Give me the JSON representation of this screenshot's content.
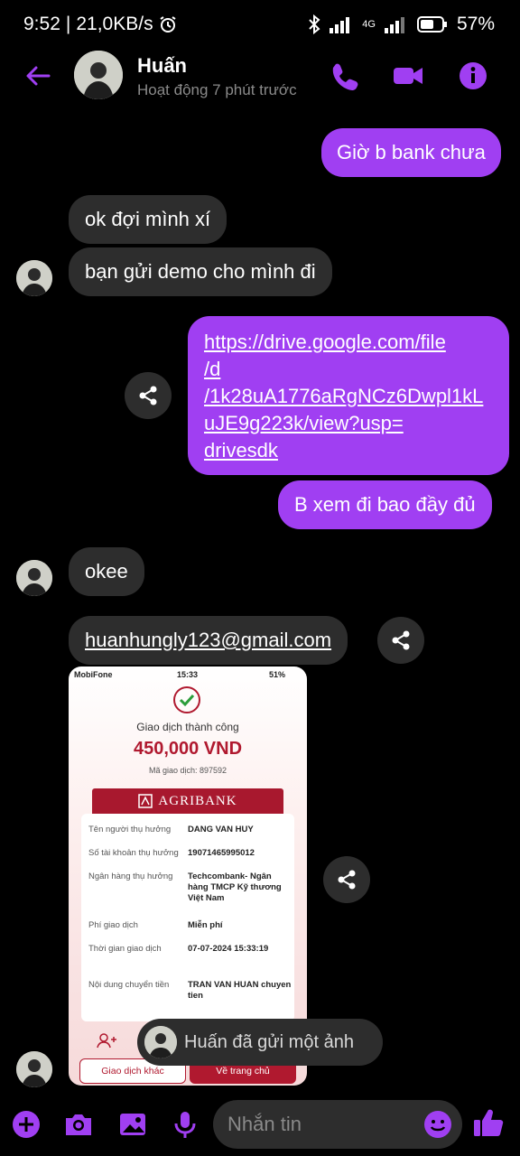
{
  "status_bar": {
    "time": "9:52",
    "speed": "21,0KB/s",
    "network": "4G",
    "battery": "57%"
  },
  "header": {
    "name": "Huấn",
    "subtitle": "Hoạt động 7 phút trước",
    "accent_color": "#a03ff2"
  },
  "messages": [
    {
      "side": "out",
      "text": "Giờ b bank chưa"
    },
    {
      "side": "in",
      "text": "ok đợi mình xí"
    },
    {
      "side": "in",
      "text": "bạn gửi demo cho mình đi"
    },
    {
      "side": "out",
      "link": true,
      "lines": [
        "https://drive.google.com/file",
        "/d",
        "/1k28uA1776aRgNCz6Dwpl1kL",
        "uJE9g223k/view?usp=",
        "drivesdk"
      ]
    },
    {
      "side": "out",
      "text": "B xem đi bao đầy đủ"
    },
    {
      "side": "in",
      "text": "okee"
    },
    {
      "side": "in",
      "link": true,
      "text": "huanhungly123@gmail.com"
    }
  ],
  "receipt": {
    "carrier": "MobiFone",
    "time": "15:33",
    "battery": "51%",
    "title": "Giao dịch thành công",
    "amount": "450,000 VND",
    "code": "Mã giao dịch: 897592",
    "bank": "AGRIBANK",
    "rows": [
      {
        "key": "Tên người thụ hưởng",
        "value": "DANG VAN HUY"
      },
      {
        "key": "Số tài khoản thụ hưởng",
        "value": "19071465995012"
      },
      {
        "key": "Ngân hàng thụ hưởng",
        "value": "Techcombank- Ngân hàng TMCP Kỹ thương Việt Nam"
      },
      {
        "key": "Phí giao dịch",
        "value": "Miễn phí"
      },
      {
        "key": "Thời gian giao dịch",
        "value": "07-07-2024 15:33:19"
      },
      {
        "key": "Nội dung chuyển tiền",
        "value": "TRAN VAN HUAN chuyen tien"
      }
    ],
    "btn_other": "Giao dịch khác",
    "btn_home": "Về trang chủ",
    "brand_color": "#a8182e"
  },
  "toast": {
    "text": "Huấn đã gửi một ảnh"
  },
  "composer": {
    "placeholder": "Nhắn tin"
  }
}
